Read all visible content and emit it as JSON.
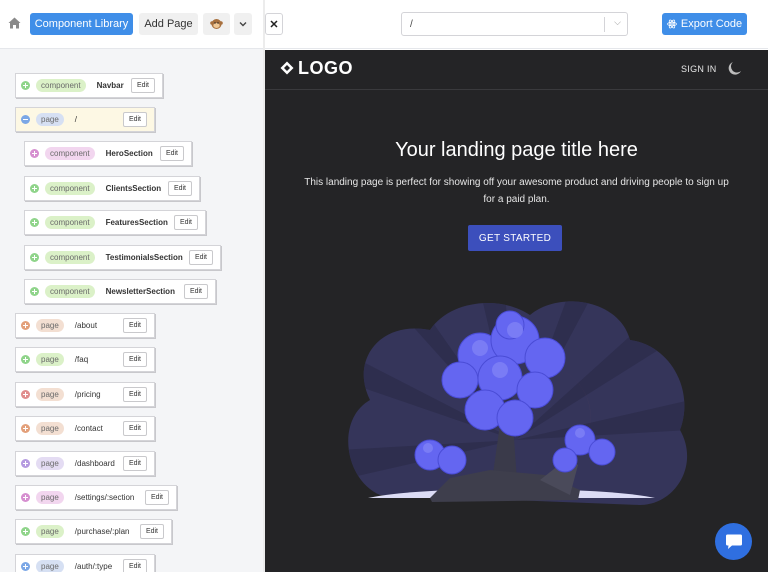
{
  "toolbar": {
    "home_icon": "home-icon",
    "component_library_label": "Component Library",
    "add_page_label": "Add Page",
    "avatar_icon": "monkey-avatar-icon",
    "dropdown_icon": "chevron-down-icon"
  },
  "tree": [
    {
      "toggle": "plus",
      "tag": "component",
      "name": "Navbar",
      "edit": "Edit"
    },
    {
      "toggle": "minus",
      "tag": "page",
      "name": "/",
      "edit": "Edit"
    },
    {
      "toggle": "plus",
      "tag": "component",
      "name": "HeroSection",
      "edit": "Edit"
    },
    {
      "toggle": "plus",
      "tag": "component",
      "name": "ClientsSection",
      "edit": "Edit"
    },
    {
      "toggle": "plus",
      "tag": "component",
      "name": "FeaturesSection",
      "edit": "Edit"
    },
    {
      "toggle": "plus",
      "tag": "component",
      "name": "TestimonialsSection",
      "edit": "Edit"
    },
    {
      "toggle": "plus",
      "tag": "component",
      "name": "NewsletterSection",
      "edit": "Edit"
    },
    {
      "toggle": "plus",
      "tag": "page",
      "name": "/about",
      "edit": "Edit"
    },
    {
      "toggle": "plus",
      "tag": "page",
      "name": "/faq",
      "edit": "Edit"
    },
    {
      "toggle": "plus",
      "tag": "page",
      "name": "/pricing",
      "edit": "Edit"
    },
    {
      "toggle": "plus",
      "tag": "page",
      "name": "/contact",
      "edit": "Edit"
    },
    {
      "toggle": "plus",
      "tag": "page",
      "name": "/dashboard",
      "edit": "Edit"
    },
    {
      "toggle": "plus",
      "tag": "page",
      "name": "/settings/:section",
      "edit": "Edit"
    },
    {
      "toggle": "plus",
      "tag": "page",
      "name": "/purchase/:plan",
      "edit": "Edit"
    },
    {
      "toggle": "plus",
      "tag": "page",
      "name": "/auth/:type",
      "edit": "Edit"
    }
  ],
  "topbar": {
    "close_icon": "close-icon",
    "close_label": "✕",
    "route_value": "/",
    "route_chevron": "⌵",
    "export_label": "Export Code",
    "export_icon": "react-icon"
  },
  "preview": {
    "logo_text": "LOGO",
    "signin_label": "SIGN IN",
    "theme_icon": "moon-icon",
    "hero_title": "Your landing page title here",
    "hero_description": "This landing page is perfect for showing off your awesome product and driving people to sign up for a paid plan.",
    "cta_label": "GET STARTED",
    "illustration": "tree-illustration"
  },
  "chat": {
    "icon": "chat-bubble-icon"
  },
  "colors": {
    "primary": "#3f8ee8",
    "cta": "#3c4fbc",
    "preview_bg": "#242426",
    "tree_foliage": "#6466f1",
    "moon": "#e06a50"
  }
}
